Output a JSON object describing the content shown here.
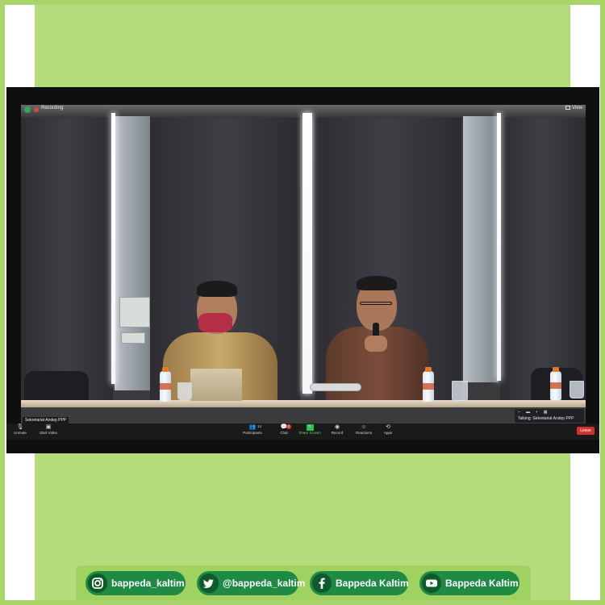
{
  "zoom": {
    "recording_label": "Recording",
    "view_label": "View",
    "participant_name": "Sekretariat Andep PPP",
    "talking_label": "Talking: Sekretariat Andep PPP",
    "toolbar": {
      "unmute": "Unmute",
      "start_video": "Start Video",
      "participants": "Participants",
      "participants_count": "14",
      "chat": "Chat",
      "chat_badge": "2",
      "share_screen": "Share Screen",
      "record": "Record",
      "reactions": "Reactions",
      "apps": "Apps",
      "leave": "Leave"
    }
  },
  "social": [
    {
      "icon": "instagram-icon",
      "label": "bappeda_kaltim"
    },
    {
      "icon": "twitter-icon",
      "label": "@bappeda_kaltim"
    },
    {
      "icon": "facebook-icon",
      "label": "Bappeda Kaltim"
    },
    {
      "icon": "youtube-icon",
      "label": "Bappeda Kaltim"
    }
  ],
  "colors": {
    "frame_green": "#a9d56b",
    "panel_green": "#b4dc7b",
    "pill_green": "#1f8a44",
    "leave_red": "#d23232",
    "share_green": "#2fbf4f"
  }
}
